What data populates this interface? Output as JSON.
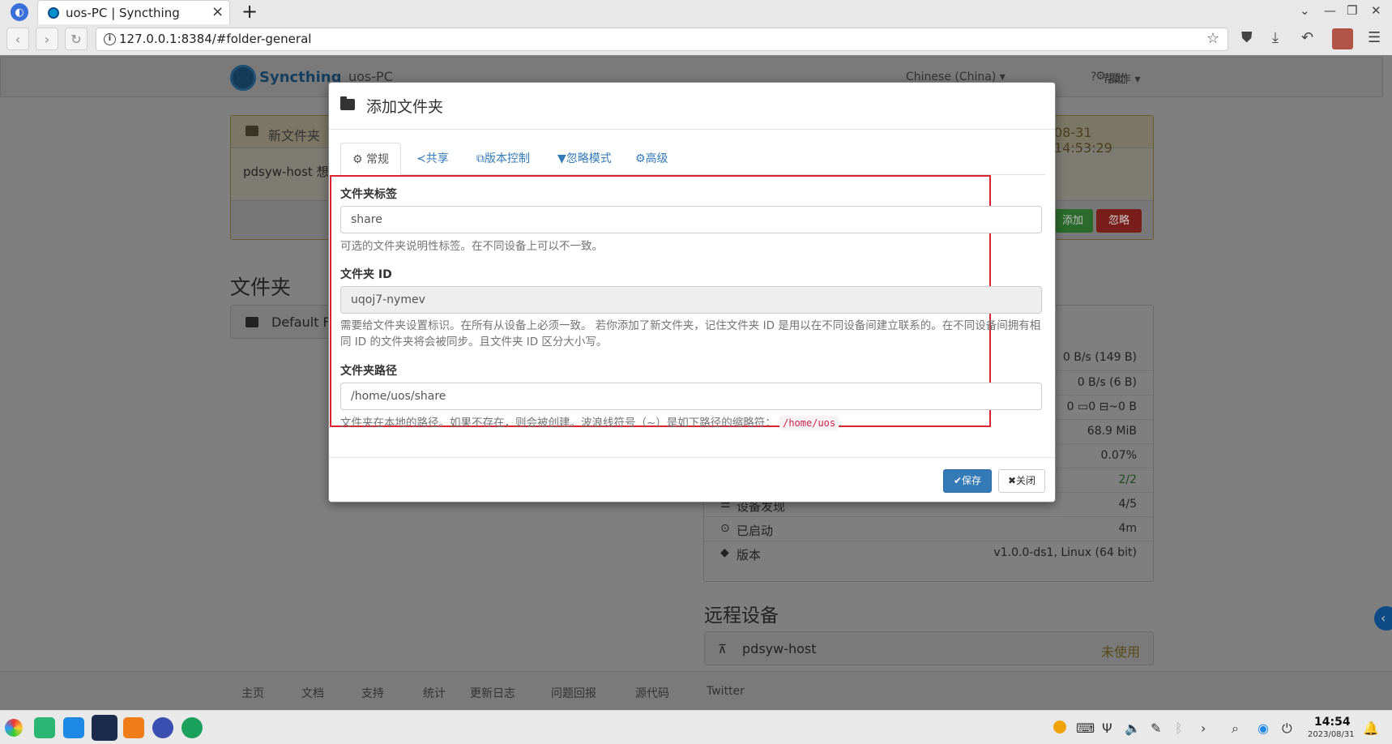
{
  "browser": {
    "tab_title": "uos-PC | Syncthing",
    "url": "127.0.0.1:8384/#folder-general"
  },
  "syncthing": {
    "brand": "Syncthing",
    "device_name": "uos-PC",
    "language": "Chinese (China) ▾",
    "help": "帮助",
    "actions": "操作 ▾",
    "notice": {
      "title": "新文件夹",
      "time": "08-31 14:53:29",
      "body": "pdsyw-host 想要",
      "add": "添加",
      "ignore": "忽略"
    },
    "folders_heading": "文件夹",
    "default_folder": "Default Fo",
    "stats": [
      {
        "icon": "",
        "label": "",
        "value": "0 B/s (149 B)"
      },
      {
        "icon": "",
        "label": "",
        "value": "0 B/s (6 B)"
      },
      {
        "icon": "",
        "label": "",
        "value": "0  ▭0  ⊟~0 B"
      },
      {
        "icon": "",
        "label": "",
        "value": "68.9 MiB"
      },
      {
        "icon": "",
        "label": "",
        "value": "0.07%"
      },
      {
        "icon": "",
        "label": "",
        "value": "2/2"
      },
      {
        "icon": "☰",
        "label": "设备发现",
        "value": "4/5"
      },
      {
        "icon": "⊙",
        "label": "已启动",
        "value": "4m"
      },
      {
        "icon": "◆",
        "label": "版本",
        "value": "v1.0.0-ds1, Linux (64 bit)"
      }
    ],
    "remote_heading": "远程设备",
    "remote_device": "pdsyw-host",
    "remote_status": "未使用",
    "footer": [
      "主页",
      "文档",
      "支持",
      "统计",
      "更新日志",
      "问题回报",
      "源代码",
      "Twitter"
    ]
  },
  "modal": {
    "title": "添加文件夹",
    "tabs": [
      "常规",
      "共享",
      "版本控制",
      "忽略模式",
      "高级"
    ],
    "label_field": {
      "label": "文件夹标签",
      "value": "share",
      "help": "可选的文件夹说明性标签。在不同设备上可以不一致。"
    },
    "id_field": {
      "label": "文件夹 ID",
      "value": "uqoj7-nymev",
      "help": "需要给文件夹设置标识。在所有从设备上必须一致。 若你添加了新文件夹，记住文件夹 ID 是用以在不同设备间建立联系的。在不同设备间拥有相同 ID 的文件夹将会被同步。且文件夹 ID 区分大小写。"
    },
    "path_field": {
      "label": "文件夹路径",
      "value": "/home/uos/share",
      "help_prefix": "文件夹在本地的路径。如果不存在，则会被创建。波浪线符号（~）是如下路径的缩略符：",
      "help_code": "/home/uos",
      "help_suffix": "."
    },
    "save": "保存",
    "close": "关闭"
  },
  "taskbar": {
    "time": "14:54",
    "date": "2023/08/31"
  },
  "colors": {
    "primary": "#337ab7",
    "highlight_frame": "#d9252f",
    "success": "#5cb85c",
    "danger": "#d9534f"
  }
}
